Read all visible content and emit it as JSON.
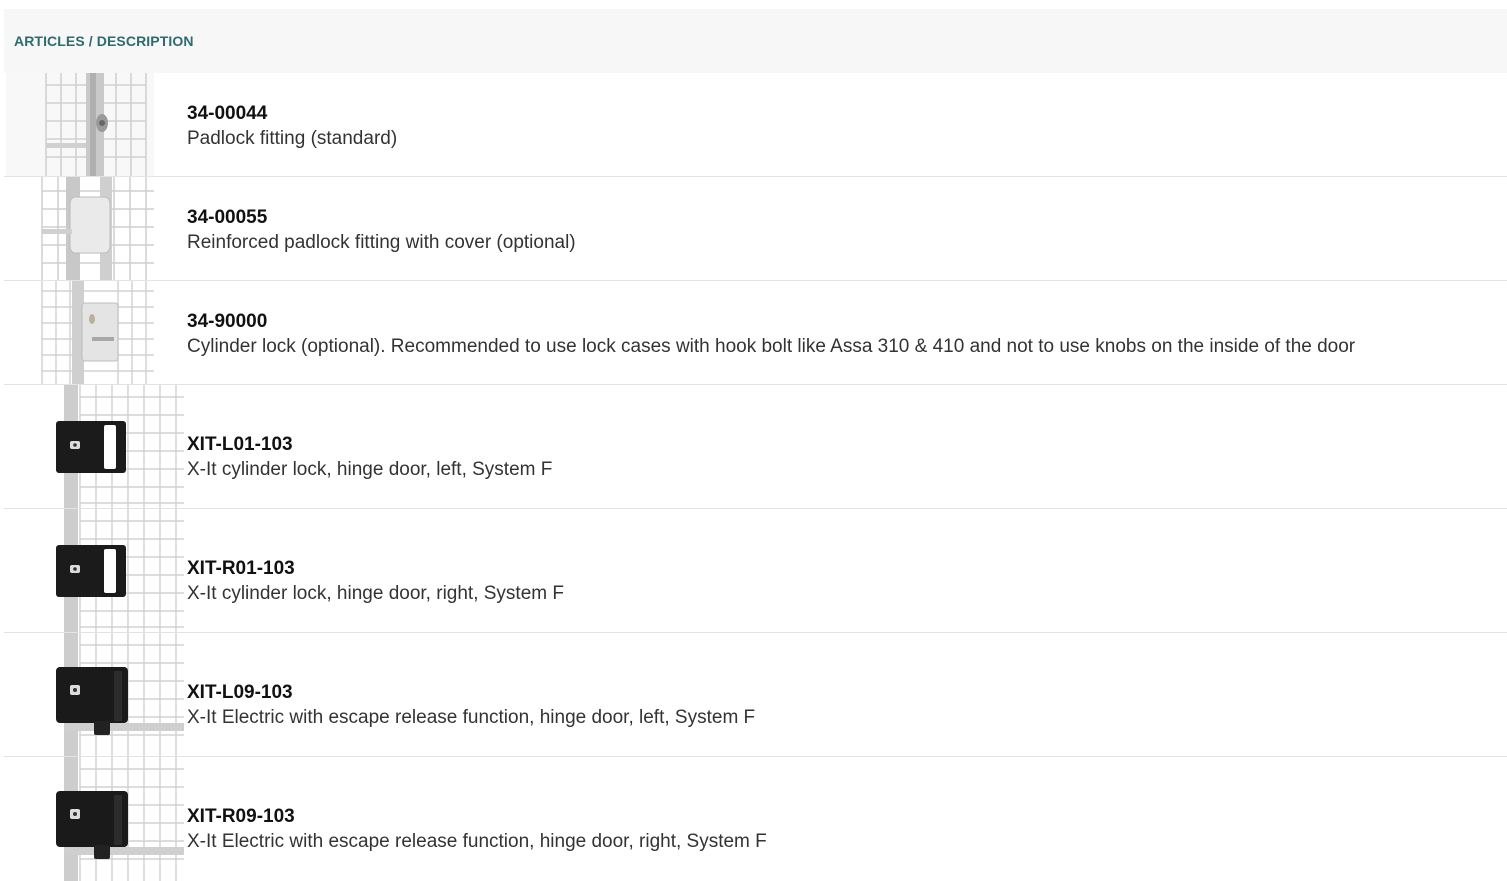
{
  "header": {
    "title": "ARTICLES / DESCRIPTION"
  },
  "articles": [
    {
      "code": "34-00044",
      "description": "Padlock fitting (standard)",
      "icon": "padlock-fitting-icon",
      "lock_color": "#c8c8c8"
    },
    {
      "code": "34-00055",
      "description": "Reinforced padlock fitting with cover (optional)",
      "icon": "padlock-cover-icon",
      "lock_color": "#e6e6e6"
    },
    {
      "code": "34-90000",
      "description": "Cylinder lock (optional). Recommended to use lock cases with hook bolt like Assa 310 & 410 and not to use knobs on the inside of the door",
      "icon": "cylinder-lock-icon",
      "lock_color": "#dcdcdc"
    },
    {
      "code": "XIT-L01-103",
      "description": "X-It cylinder lock, hinge door, left, System F",
      "icon": "xit-lock-icon",
      "lock_color": "#1a1a1a"
    },
    {
      "code": "XIT-R01-103",
      "description": "X-It cylinder lock, hinge door, right, System F",
      "icon": "xit-lock-icon",
      "lock_color": "#1a1a1a"
    },
    {
      "code": "XIT-L09-103",
      "description": "X-It Electric with escape release function, hinge door, left, System F",
      "icon": "xit-electric-icon",
      "lock_color": "#1a1a1a"
    },
    {
      "code": "XIT-R09-103",
      "description": "X-It Electric with escape release function, hinge door, right, System F",
      "icon": "xit-electric-icon",
      "lock_color": "#1a1a1a"
    }
  ]
}
